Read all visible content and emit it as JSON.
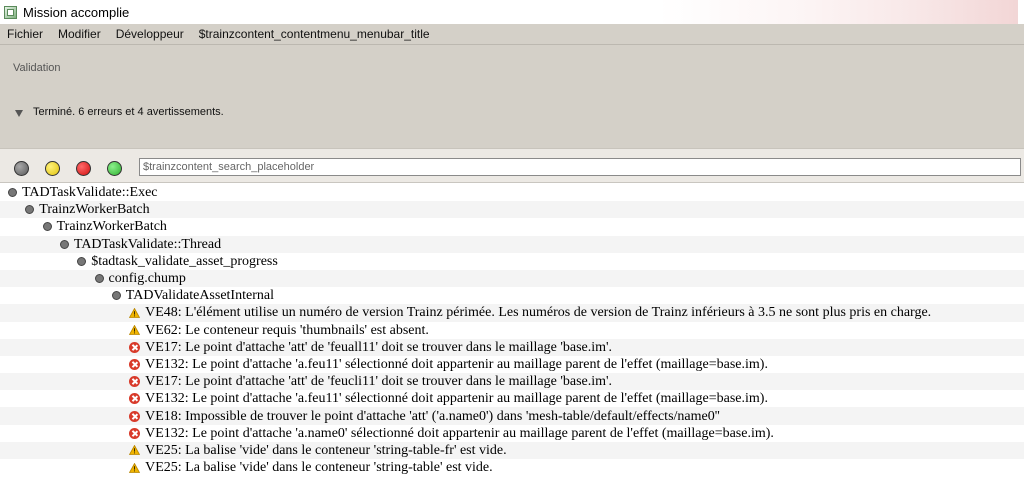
{
  "window": {
    "title": "Mission accomplie"
  },
  "menubar": {
    "items": [
      {
        "label": "Fichier"
      },
      {
        "label": "Modifier"
      },
      {
        "label": "Développeur"
      },
      {
        "label": "$trainzcontent_contentmenu_menubar_title"
      }
    ]
  },
  "validation": {
    "label": "Validation",
    "status": "Terminé. 6 erreurs et 4 avertissements."
  },
  "toolbar": {
    "filters": [
      {
        "name": "all-filter",
        "color": "#6e6e6e"
      },
      {
        "name": "warning-filter",
        "color": "#f1d51e"
      },
      {
        "name": "error-filter",
        "color": "#e01b1b"
      },
      {
        "name": "success-filter",
        "color": "#3cc63c"
      }
    ],
    "search_placeholder": "$trainzcontent_search_placeholder"
  },
  "tree": {
    "rows": [
      {
        "level": 0,
        "icon": "bullet",
        "text": "TADTaskValidate::Exec"
      },
      {
        "level": 1,
        "icon": "bullet",
        "text": "TrainzWorkerBatch"
      },
      {
        "level": 2,
        "icon": "bullet",
        "text": "TrainzWorkerBatch"
      },
      {
        "level": 3,
        "icon": "bullet",
        "text": "TADTaskValidate::Thread"
      },
      {
        "level": 4,
        "icon": "bullet",
        "text": "$tadtask_validate_asset_progress"
      },
      {
        "level": 5,
        "icon": "bullet",
        "text": "config.chump"
      },
      {
        "level": 6,
        "icon": "bullet",
        "text": "TADValidateAssetInternal"
      },
      {
        "level": 7,
        "icon": "warning",
        "text": "VE48: L'élément utilise un numéro de version Trainz périmée. Les numéros de version de Trainz inférieurs à 3.5 ne sont plus pris en charge."
      },
      {
        "level": 7,
        "icon": "warning",
        "text": "VE62: Le conteneur requis 'thumbnails' est absent."
      },
      {
        "level": 7,
        "icon": "error",
        "text": "VE17: Le point d'attache 'att' de 'feuall11' doit se trouver dans le maillage 'base.im'."
      },
      {
        "level": 7,
        "icon": "error",
        "text": "VE132: Le point d'attache 'a.feu11' sélectionné doit appartenir au maillage parent de l'effet (maillage=base.im)."
      },
      {
        "level": 7,
        "icon": "error",
        "text": "VE17: Le point d'attache 'att' de 'feucli11' doit se trouver dans le maillage 'base.im'."
      },
      {
        "level": 7,
        "icon": "error",
        "text": "VE132: Le point d'attache 'a.feu11' sélectionné doit appartenir au maillage parent de l'effet (maillage=base.im)."
      },
      {
        "level": 7,
        "icon": "error",
        "text": "VE18: Impossible de trouver le point d'attache 'att' ('a.name0') dans 'mesh-table/default/effects/name0''"
      },
      {
        "level": 7,
        "icon": "error",
        "text": "VE132: Le point d'attache 'a.name0' sélectionné doit appartenir au maillage parent de l'effet (maillage=base.im)."
      },
      {
        "level": 7,
        "icon": "warning",
        "text": "VE25: La balise 'vide' dans le conteneur 'string-table-fr' est vide."
      },
      {
        "level": 7,
        "icon": "warning",
        "text": "VE25: La balise 'vide' dans le conteneur 'string-table' est vide."
      }
    ]
  }
}
